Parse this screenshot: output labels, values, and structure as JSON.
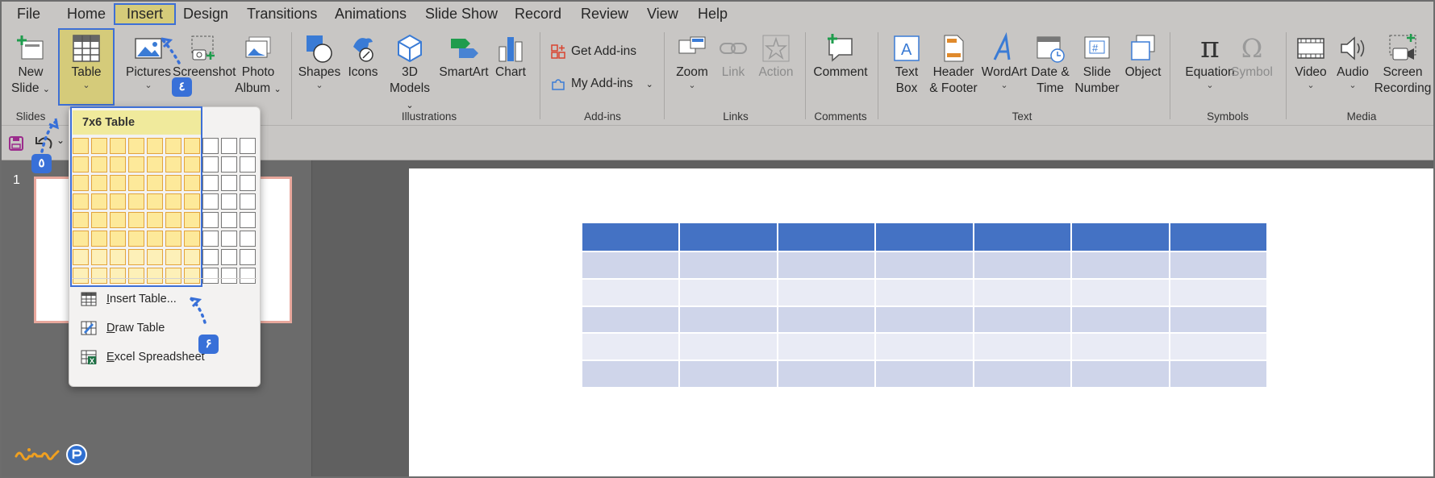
{
  "menu": {
    "tabs": [
      "File",
      "Home",
      "Insert",
      "Design",
      "Transitions",
      "Animations",
      "Slide Show",
      "Record",
      "Review",
      "View",
      "Help"
    ],
    "active": "Insert"
  },
  "ribbon": {
    "new_slide": [
      "New",
      "Slide"
    ],
    "table": "Table",
    "pictures": "Pictures",
    "screenshot": "Screenshot",
    "photo_album": [
      "Photo",
      "Album"
    ],
    "shapes": "Shapes",
    "icons": "Icons",
    "models_3d": [
      "3D",
      "Models"
    ],
    "smartart": "SmartArt",
    "chart": "Chart",
    "get_addins": "Get Add-ins",
    "my_addins": "My Add-ins",
    "zoom": "Zoom",
    "link": "Link",
    "action": "Action",
    "comment": "Comment",
    "text_box": [
      "Text",
      "Box"
    ],
    "header_footer": [
      "Header",
      "& Footer"
    ],
    "wordart": "WordArt",
    "date_time": [
      "Date &",
      "Time"
    ],
    "slide_number": [
      "Slide",
      "Number"
    ],
    "object": "Object",
    "equation": "Equation",
    "symbol": "Symbol",
    "video": "Video",
    "audio": "Audio",
    "screen_recording": [
      "Screen",
      "Recording"
    ],
    "groups": {
      "slides": "Slides",
      "illustrations": "Illustrations",
      "addins": "Add-ins",
      "links": "Links",
      "comments": "Comments",
      "text": "Text",
      "symbols": "Symbols",
      "media": "Media"
    }
  },
  "thumbnail": {
    "number": "1"
  },
  "dropdown": {
    "title": "7x6 Table",
    "grid_cols": 10,
    "grid_rows": 8,
    "selected_cols": 7,
    "selected_rows": 6,
    "items": [
      {
        "label": "Insert Table...",
        "underline": "I",
        "rest": "nsert Table..."
      },
      {
        "label": "Draw Table",
        "underline": "D",
        "rest": "raw Table"
      },
      {
        "label": "Excel Spreadsheet",
        "underline": "E",
        "rest": "xcel Spreadsheet"
      }
    ]
  },
  "slide_table": {
    "cols": 7,
    "rows": 6,
    "header_color": "#4472c4",
    "row_color_a": "#cfd5ea",
    "row_color_b": "#e9ebf5"
  },
  "annotations": {
    "step4": "٤",
    "step5": "٥",
    "step6": "۶"
  },
  "colors": {
    "accent": "#3d6fd6",
    "ribbon_bg": "#c8c6c4",
    "active_tab": "#d5cb7a"
  }
}
